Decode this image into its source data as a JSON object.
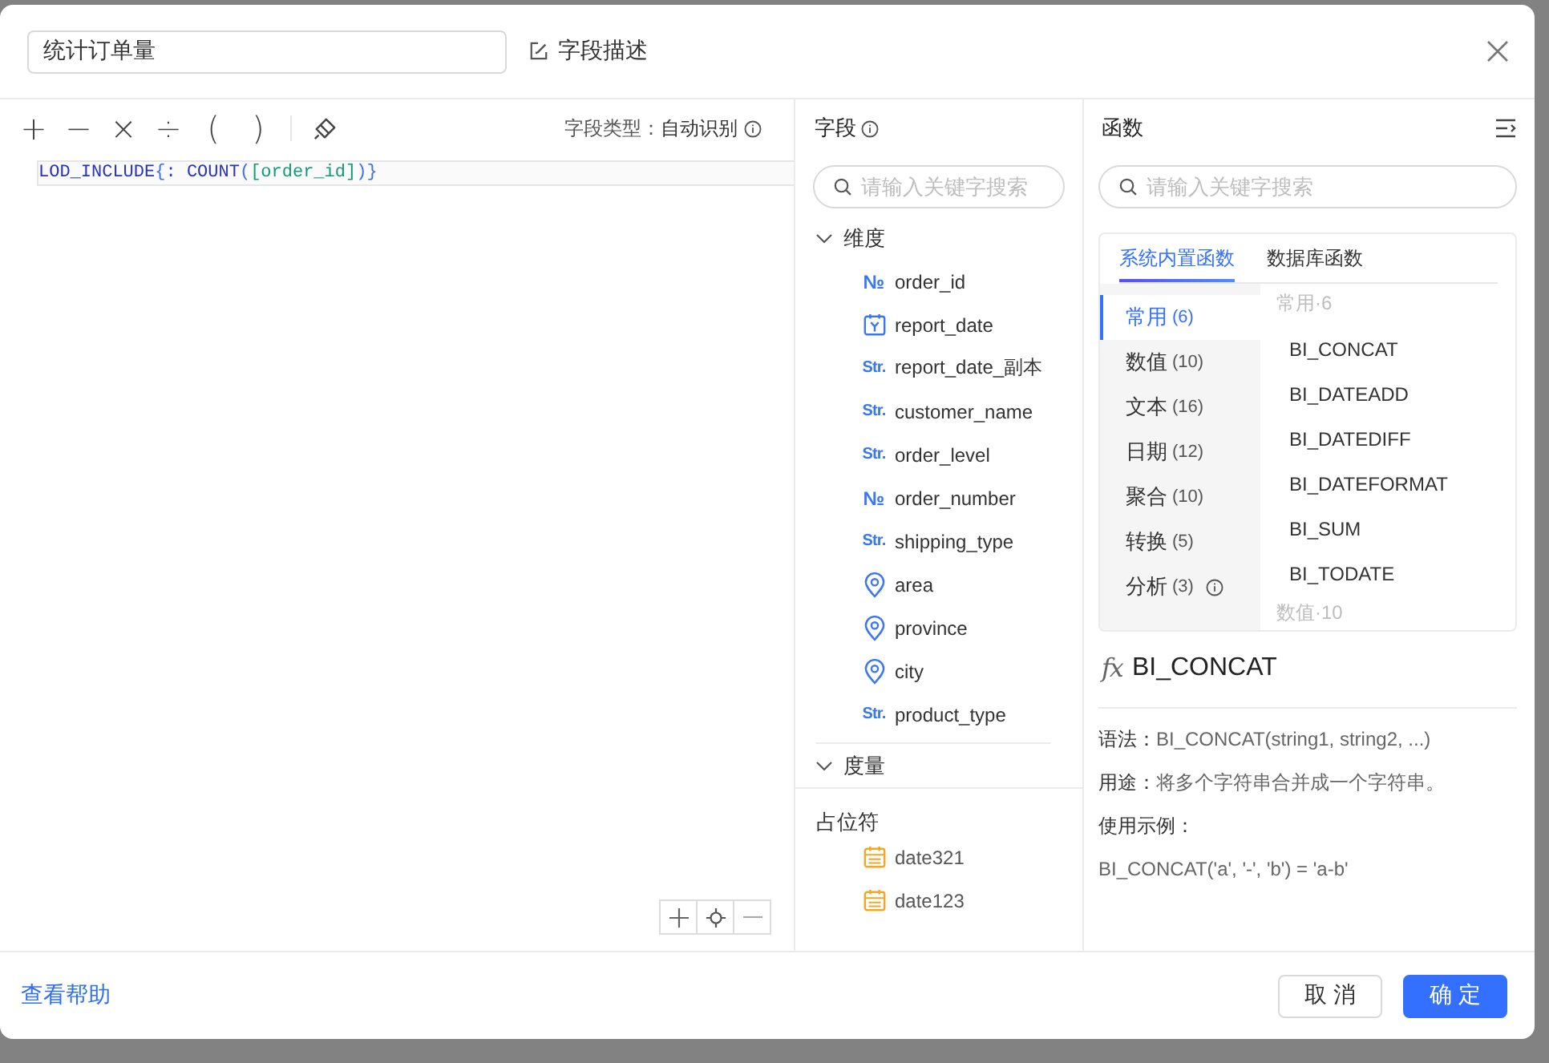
{
  "header": {
    "name_value": "统计订单量",
    "description_link": "字段描述"
  },
  "editor": {
    "operators": [
      "+",
      "−",
      "×",
      "÷",
      "(",
      ")"
    ],
    "field_type": {
      "label": "字段类型：",
      "value": "自动识别"
    },
    "formula_tokens": [
      {
        "kind": "keyword",
        "text": "LOD_INCLUDE"
      },
      {
        "kind": "bracket",
        "text": "{"
      },
      {
        "kind": "plain",
        "text": ": "
      },
      {
        "kind": "keyword",
        "text": "COUNT"
      },
      {
        "kind": "bracket",
        "text": "("
      },
      {
        "kind": "field",
        "text": "[order_id]"
      },
      {
        "kind": "bracket",
        "text": ")"
      },
      {
        "kind": "bracket",
        "text": "}"
      }
    ]
  },
  "fields": {
    "title": "字段",
    "search": {
      "placeholder": "请输入关键字搜索"
    },
    "groups": [
      {
        "label": "维度",
        "expanded": true,
        "children": [
          {
            "kind": "number",
            "badge": "№",
            "name": "order_id"
          },
          {
            "kind": "date",
            "name": "report_date"
          },
          {
            "kind": "string",
            "badge": "Str.",
            "name": "report_date_副本"
          },
          {
            "kind": "string",
            "badge": "Str.",
            "name": "customer_name"
          },
          {
            "kind": "string",
            "badge": "Str.",
            "name": "order_level"
          },
          {
            "kind": "number",
            "badge": "№",
            "name": "order_number"
          },
          {
            "kind": "string",
            "badge": "Str.",
            "name": "shipping_type"
          },
          {
            "kind": "geo",
            "name": "area"
          },
          {
            "kind": "geo",
            "name": "province"
          },
          {
            "kind": "geo",
            "name": "city"
          },
          {
            "kind": "string",
            "badge": "Str.",
            "name": "product_type"
          }
        ]
      },
      {
        "label": "度量",
        "expanded": true
      }
    ],
    "placeholders": {
      "title": "占位符",
      "items": [
        {
          "name": "date321"
        },
        {
          "name": "date123"
        }
      ]
    }
  },
  "functions": {
    "title": "函数",
    "search": {
      "placeholder": "请输入关键字搜索"
    },
    "tabs": [
      {
        "label": "系统内置函数",
        "selected": true
      },
      {
        "label": "数据库函数",
        "selected": false
      }
    ],
    "categories": [
      {
        "label": "常用",
        "count": "(6)",
        "selected": true,
        "info": false
      },
      {
        "label": "数值",
        "count": "(10)",
        "selected": false,
        "info": false
      },
      {
        "label": "文本",
        "count": "(16)",
        "selected": false,
        "info": false
      },
      {
        "label": "日期",
        "count": "(12)",
        "selected": false,
        "info": false
      },
      {
        "label": "聚合",
        "count": "(10)",
        "selected": false,
        "info": false
      },
      {
        "label": "转换",
        "count": "(5)",
        "selected": false,
        "info": false
      },
      {
        "label": "分析",
        "count": "(3)",
        "selected": false,
        "info": true
      }
    ],
    "list": [
      {
        "heading": "常用·6",
        "items": [
          "BI_CONCAT",
          "BI_DATEADD",
          "BI_DATEDIFF",
          "BI_DATEFORMAT",
          "BI_SUM",
          "BI_TODATE"
        ]
      },
      {
        "heading": "数值·10"
      }
    ],
    "detail": {
      "symbol": "fx",
      "name": "BI_CONCAT",
      "syntax": {
        "label": "语法：",
        "text": "BI_CONCAT(string1, string2, ...)"
      },
      "usage": {
        "label": "用途：",
        "text": "将多个字符串合并成一个字符串。"
      },
      "example_label": "使用示例：",
      "example": "BI_CONCAT('a', '-', 'b') = 'a-b'"
    }
  },
  "footer": {
    "help_link": "查看帮助",
    "buttons": [
      {
        "kind": "default",
        "label": "取 消"
      },
      {
        "kind": "primary",
        "label": "确 定"
      }
    ]
  }
}
